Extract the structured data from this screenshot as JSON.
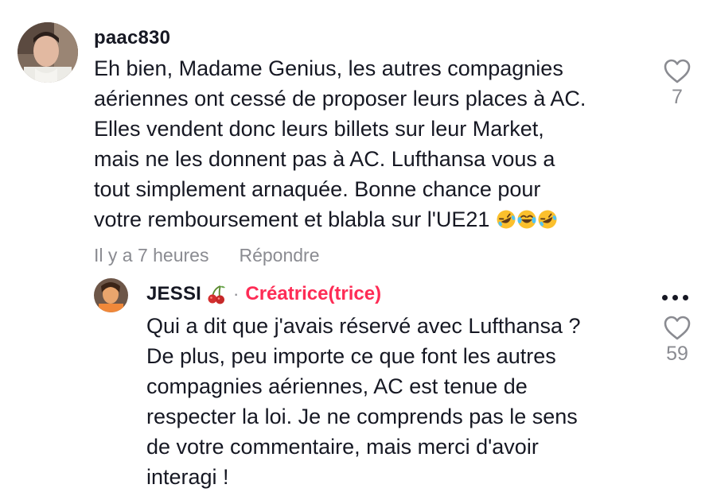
{
  "comment": {
    "username": "paac830",
    "text_lines": [
      "Eh bien, Madame Genius, les autres compagnies",
      "aériennes ont cessé de proposer leurs places à AC.",
      "Elles vendent donc leurs billets sur leur Market,",
      "mais ne les donnent pas à AC. Lufthansa vous a",
      "tout simplement arnaquée. Bonne chance pour",
      "votre remboursement et blabla sur l'UE21"
    ],
    "emojis": [
      "rolling-on-floor-laughing",
      "face-with-tears-of-joy",
      "rolling-on-floor-laughing"
    ],
    "timestamp": "Il y a 7 heures",
    "reply_label": "Répondre",
    "like_count": "7",
    "like_icon": "heart-outline-icon"
  },
  "reply": {
    "username": "JESSI",
    "username_emoji": "cherries",
    "separator": "·",
    "badge": "Créatrice(trice)",
    "badge_color": "#fe2c55",
    "text_lines": [
      "Qui a dit que j'avais réservé avec Lufthansa ?",
      "De plus, peu importe ce que font les autres",
      "compagnies aériennes, AC est tenue de",
      "respecter la loi. Je ne comprends pas le sens",
      "de votre commentaire, mais merci d'avoir",
      "interagi !"
    ],
    "like_count": "59",
    "like_icon": "heart-outline-icon",
    "more_icon": "more-dots-icon"
  }
}
